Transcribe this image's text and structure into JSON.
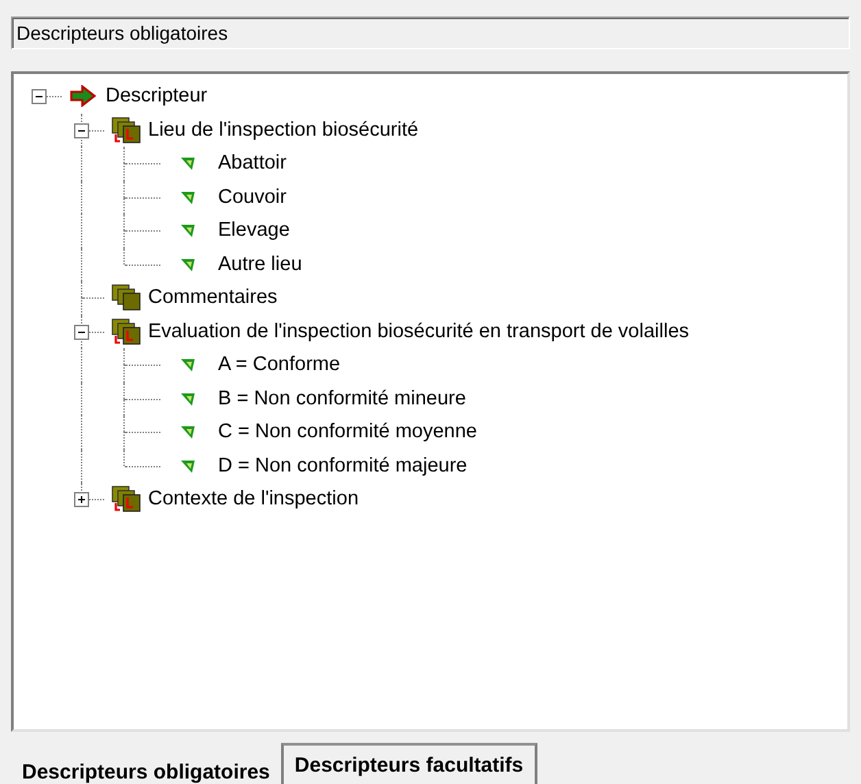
{
  "header": {
    "title": "Descripteurs obligatoires"
  },
  "tree": [
    {
      "label": "Descripteur",
      "kind": "root",
      "expanded": true,
      "children": [
        {
          "label": "Lieu de l'inspection biosécurité",
          "kind": "group",
          "flagged": true,
          "expanded": true,
          "children": [
            {
              "label": "Abattoir",
              "kind": "leaf"
            },
            {
              "label": "Couvoir",
              "kind": "leaf"
            },
            {
              "label": "Elevage",
              "kind": "leaf"
            },
            {
              "label": "Autre lieu",
              "kind": "leaf"
            }
          ]
        },
        {
          "label": "Commentaires",
          "kind": "group",
          "flagged": false
        },
        {
          "label": "Evaluation de l'inspection biosécurité en transport de volailles",
          "kind": "group",
          "flagged": true,
          "expanded": true,
          "children": [
            {
              "label": "A = Conforme",
              "kind": "leaf"
            },
            {
              "label": "B = Non conformité mineure",
              "kind": "leaf"
            },
            {
              "label": "C = Non conformité moyenne",
              "kind": "leaf"
            },
            {
              "label": "D = Non conformité majeure",
              "kind": "leaf"
            }
          ]
        },
        {
          "label": "Contexte de l'inspection",
          "kind": "group",
          "flagged": true,
          "expanded": false
        }
      ]
    }
  ],
  "tabs": [
    {
      "label": "Descripteurs obligatoires",
      "selected": true
    },
    {
      "label": "Descripteurs facultatifs",
      "selected": false
    }
  ]
}
